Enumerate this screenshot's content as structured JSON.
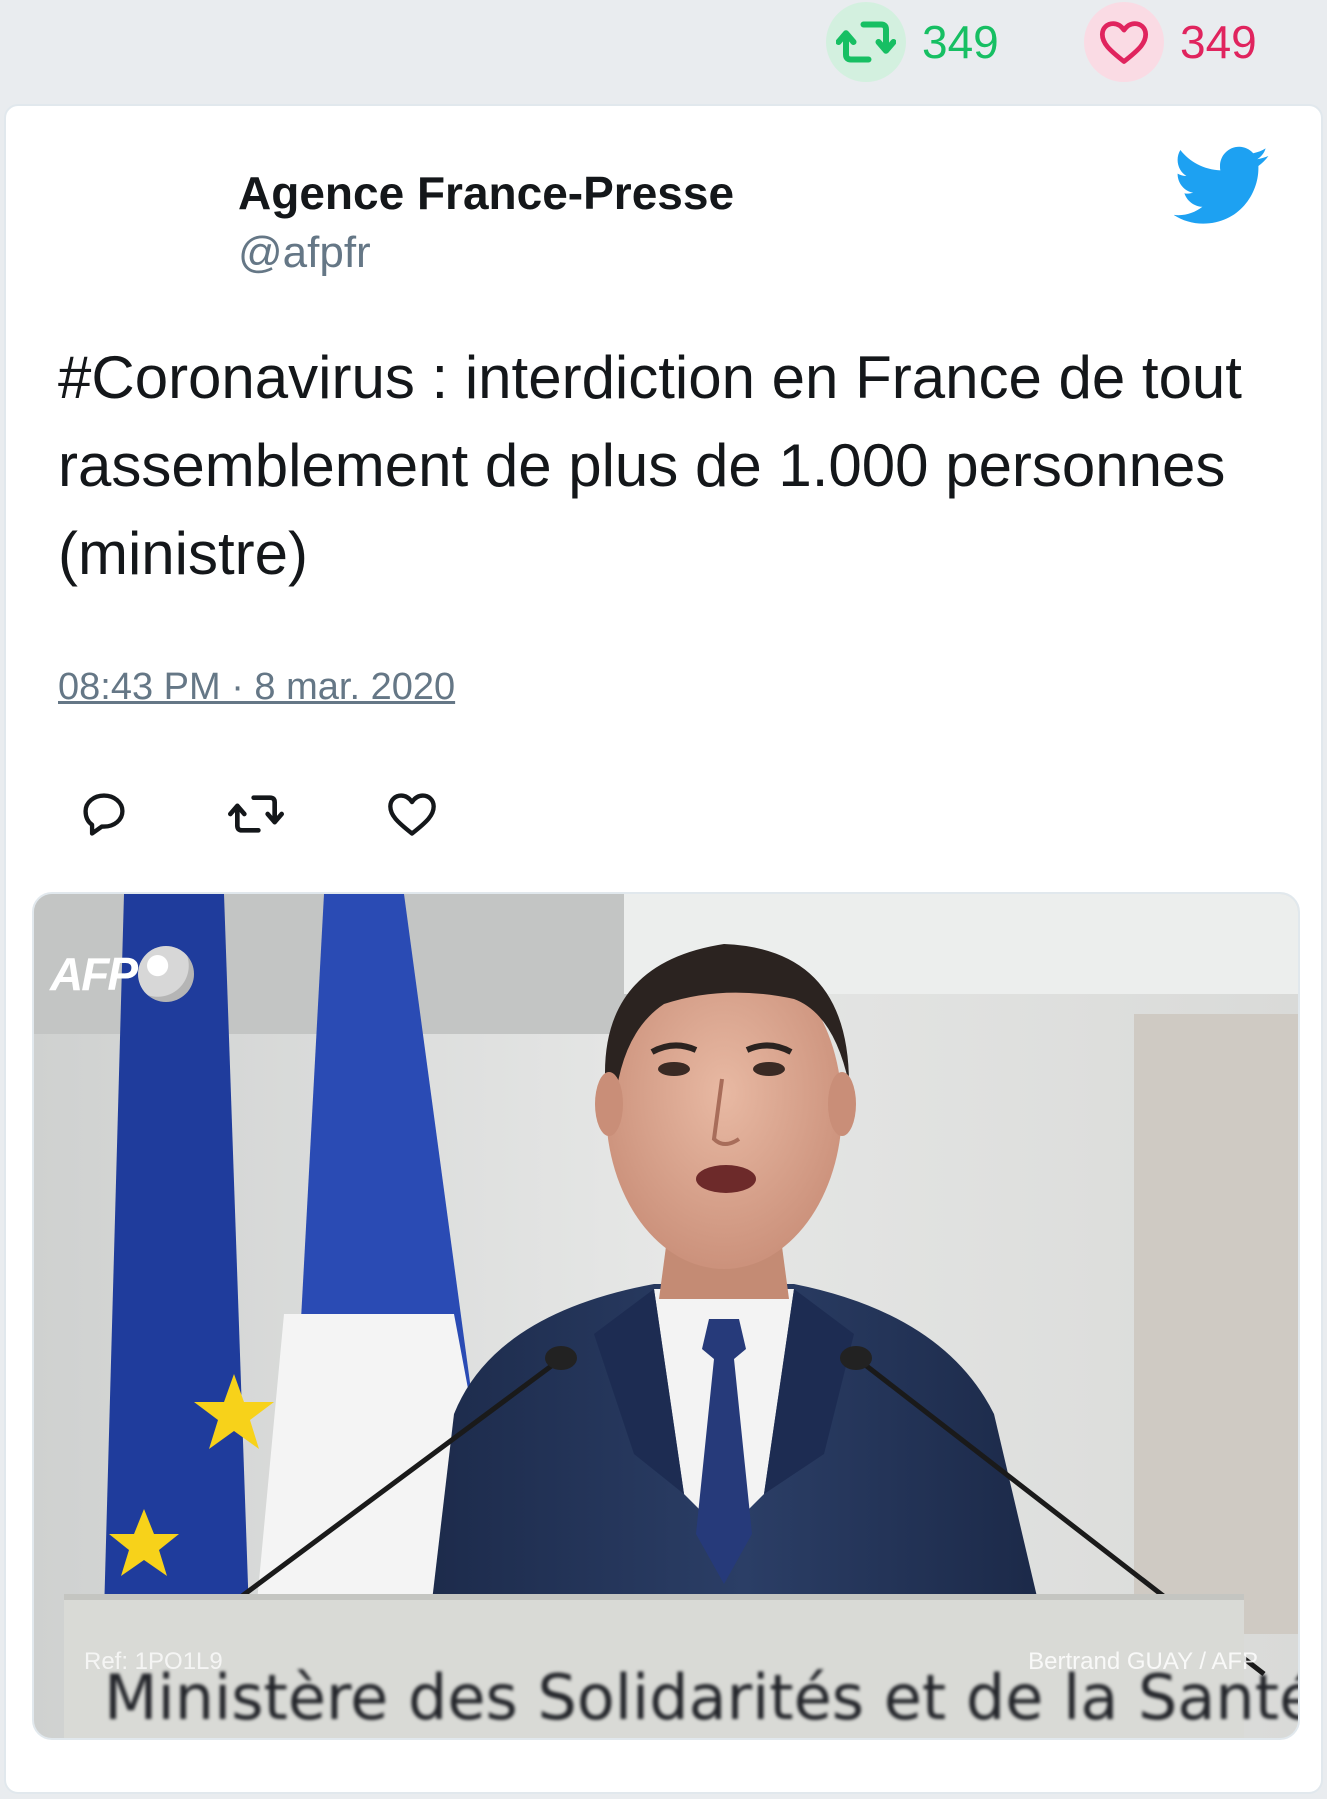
{
  "stats": {
    "retweet_icon": "retweet-icon",
    "retweet_count": "349",
    "like_icon": "heart-icon",
    "like_count": "349",
    "retweet_color": "#17bf63",
    "like_color": "#e0245e"
  },
  "tweet": {
    "author_name": "Agence France-Presse",
    "author_handle": "@afpfr",
    "brand_icon": "twitter-bird-icon",
    "brand_color": "#1da1f2",
    "text": "#Coronavirus : interdiction en France de tout rassemblement de plus de 1.000 personnes (ministre)",
    "timestamp": "08:43 PM · 8 mar. 2020",
    "actions": [
      {
        "icon": "reply-icon"
      },
      {
        "icon": "retweet-icon"
      },
      {
        "icon": "heart-icon"
      }
    ]
  },
  "media": {
    "logo_text": "AFP",
    "ref_text": "Ref: 1PO1L9",
    "credit_text": "Bertrand GUAY / AFP",
    "podium_text": "Ministère des Solidarités et de la Santé"
  }
}
